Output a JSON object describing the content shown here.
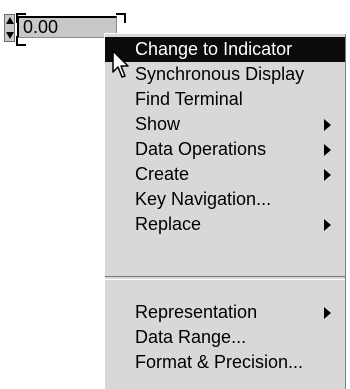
{
  "numeric_control": {
    "value": "0.00"
  },
  "context_menu": {
    "items": [
      {
        "label": "Change to Indicator",
        "submenu": false,
        "selected": true
      },
      {
        "label": "Synchronous Display",
        "submenu": false
      },
      {
        "label": "Find Terminal",
        "submenu": false
      },
      {
        "label": "Show",
        "submenu": true
      },
      {
        "label": "Data Operations",
        "submenu": true
      },
      {
        "label": "Create",
        "submenu": true
      },
      {
        "label": "Key Navigation...",
        "submenu": false
      },
      {
        "label": "Replace",
        "submenu": true
      },
      {
        "label": "Representation",
        "submenu": true
      },
      {
        "label": "Data Range...",
        "submenu": false
      },
      {
        "label": "Format & Precision...",
        "submenu": false
      }
    ]
  },
  "icons": {
    "spinner_up": "triangle-up-icon",
    "spinner_down": "triangle-down-icon",
    "submenu": "submenu-arrow-icon",
    "cursor": "mouse-pointer-icon"
  },
  "colors": {
    "menu_background": "#d8d8d8",
    "selection_background": "#0b0b0b",
    "display_background": "#c8c8c8"
  }
}
